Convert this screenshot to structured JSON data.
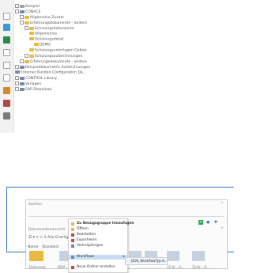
{
  "tree": {
    "nodes": [
      {
        "label": "Beispiel"
      },
      {
        "label": "CONACE"
      },
      {
        "label": "Allgemeine Zusatz"
      },
      {
        "label": "Erfahrungsdokumente - andere"
      },
      {
        "label": "Schulungsdokumente"
      },
      {
        "label": "Allgemeines"
      },
      {
        "label": "Schulungsdetail"
      },
      {
        "label": "DEMO"
      },
      {
        "label": "Schulungsunterlagen Gebiet"
      },
      {
        "label": "Schulungsaufzeichnungen"
      },
      {
        "label": "Erfahrungsdokumente - andere"
      },
      {
        "label": "Beispieldokumente Aufzeichnungen"
      },
      {
        "label": "Externer Kunden Configuration Da..."
      },
      {
        "label": "CONTROL Library"
      },
      {
        "label": "Vorlagen"
      },
      {
        "label": "SAP Download"
      }
    ]
  },
  "panel": {
    "search_label": "Suchen",
    "collapse_glyph": "^",
    "sub_label": "Dokumentenansicht",
    "view_controls": "☰  ▾  ▽  >  1 Alle Einträge  ▾",
    "tabs": [
      "Name",
      "Standard"
    ],
    "tiles": [
      {
        "label": "Dokument"
      },
      {
        "label": "DEM..."
      },
      {
        "label": ""
      },
      {
        "label": ""
      },
      {
        "label": "11/4/... 0..."
      },
      {
        "label": "11/4/... 0..."
      }
    ]
  },
  "context_menu": {
    "items": [
      {
        "label": "Zu Bezugsgruppe hinzufügen",
        "icon": "add-group-icon",
        "bold": true
      },
      {
        "label": "Öffnen",
        "icon": "open-icon",
        "bold": false
      },
      {
        "label": "Bearbeiten",
        "icon": "edit-icon",
        "bold": false
      },
      {
        "label": "Exportieren",
        "icon": "export-icon",
        "bold": false
      },
      {
        "label": "Verknüpfungen",
        "icon": "link-icon",
        "bold": false
      },
      {
        "label": "Workflows",
        "icon": "workflow-icon",
        "bold": false,
        "highlight": true,
        "has_sub": true
      },
      {
        "label": "Neue Ordner erstellen",
        "icon": "new-folder-icon",
        "bold": false
      }
    ],
    "submenu": {
      "label": "DOK_WorkflowTyp.A.."
    }
  },
  "colors": {
    "accent": "#2f73c8",
    "folder": "#e9b941",
    "green": "#2fa84f"
  }
}
